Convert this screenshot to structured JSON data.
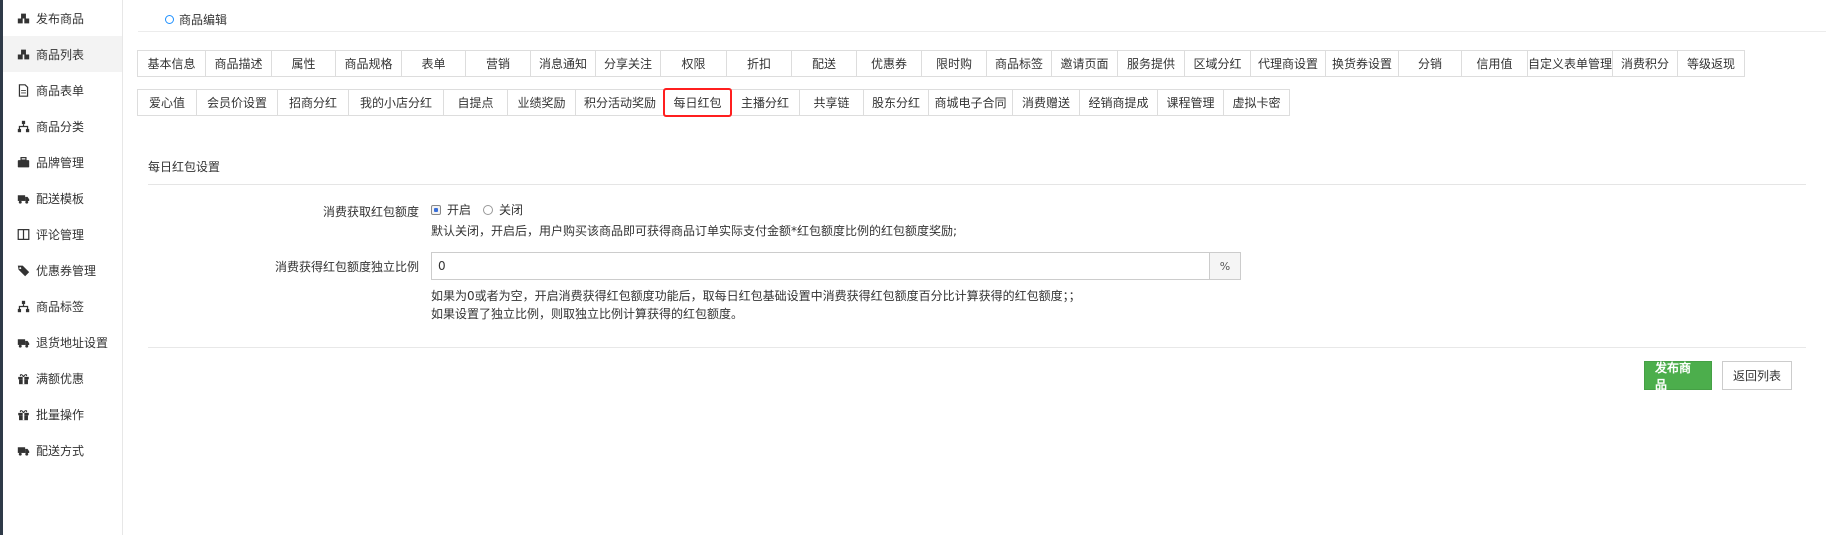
{
  "sidebar": {
    "items": [
      {
        "label": "发布商品",
        "icon": "cubes-icon",
        "active": false
      },
      {
        "label": "商品列表",
        "icon": "cubes-icon",
        "active": true
      },
      {
        "label": "商品表单",
        "icon": "file-icon",
        "active": false
      },
      {
        "label": "商品分类",
        "icon": "sitemap-icon",
        "active": false
      },
      {
        "label": "品牌管理",
        "icon": "briefcase-icon",
        "active": false
      },
      {
        "label": "配送模板",
        "icon": "truck-icon",
        "active": false
      },
      {
        "label": "评论管理",
        "icon": "columns-icon",
        "active": false
      },
      {
        "label": "优惠券管理",
        "icon": "tags-icon",
        "active": false
      },
      {
        "label": "商品标签",
        "icon": "sitemap-icon",
        "active": false
      },
      {
        "label": "退货地址设置",
        "icon": "truck-icon",
        "active": false
      },
      {
        "label": "满额优惠",
        "icon": "gift-icon",
        "active": false
      },
      {
        "label": "批量操作",
        "icon": "gift-icon",
        "active": false
      },
      {
        "label": "配送方式",
        "icon": "truck-icon",
        "active": false
      }
    ]
  },
  "header": {
    "title": "商品编辑"
  },
  "tabs_row1": [
    "基本信息",
    "商品描述",
    "属性",
    "商品规格",
    "表单",
    "营销",
    "消息通知",
    "分享关注",
    "权限",
    "折扣",
    "配送",
    "优惠券",
    "限时购",
    "商品标签",
    "邀请页面",
    "服务提供",
    "区域分红",
    "代理商设置",
    "换货券设置",
    "分销",
    "信用值",
    "自定义表单管理",
    "消费积分",
    "等级返现"
  ],
  "tabs_row2": [
    "爱心值",
    "会员价设置",
    "招商分红",
    "我的小店分红",
    "自提点",
    "业绩奖励",
    "积分活动奖励",
    "每日红包",
    "主播分红",
    "共享链",
    "股东分红",
    "商城电子合同",
    "消费赠送",
    "经销商提成",
    "课程管理",
    "虚拟卡密"
  ],
  "active_tab": "每日红包",
  "section": {
    "title": "每日红包设置"
  },
  "form": {
    "enable_label": "消费获取红包额度",
    "opt_on": "开启",
    "opt_off": "关闭",
    "enable_hint": "默认关闭，开启后，用户购买该商品即可获得商品订单实际支付金额*红包额度比例的红包额度奖励;",
    "ratio_label": "消费获得红包额度独立比例",
    "ratio_value": "0",
    "ratio_unit": "%",
    "ratio_hint1": "如果为0或者为空，开启消费获得红包额度功能后，取每日红包基础设置中消费获得红包额度百分比计算获得的红包额度；；",
    "ratio_hint2": "如果设置了独立比例，则取独立比例计算获得的红包额度。"
  },
  "buttons": {
    "publish": "发布商品",
    "back": "返回列表"
  },
  "colors": {
    "primary_green": "#4cae4c",
    "highlight_red": "#ff1f1f",
    "accent_blue": "#1e90ff"
  }
}
